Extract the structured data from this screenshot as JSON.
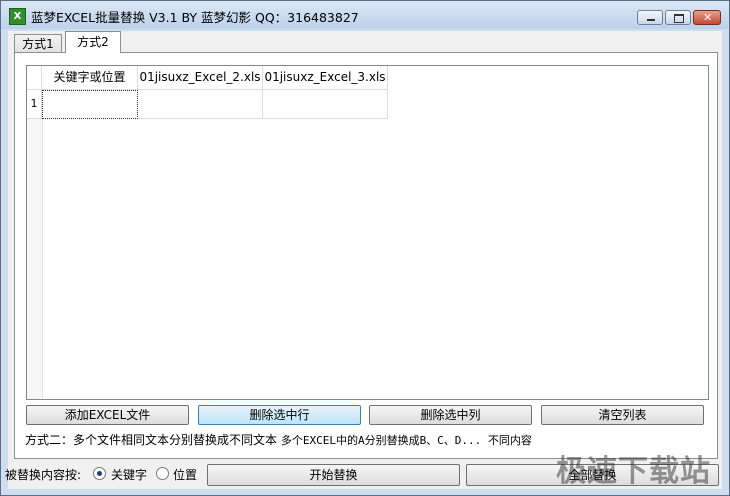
{
  "window": {
    "title": "蓝梦EXCEL批量替换 V3.1 BY 蓝梦幻影 QQ：316483827",
    "icon_letter": "X"
  },
  "tabs": [
    {
      "label": "方式1",
      "active": false
    },
    {
      "label": "方式2",
      "active": true
    }
  ],
  "grid": {
    "columns": [
      "关键字或位置",
      "01jisuxz_Excel_2.xls",
      "01jisuxz_Excel_3.xls"
    ],
    "rows": [
      {
        "row_number": "1",
        "cells": [
          "",
          "",
          ""
        ]
      }
    ]
  },
  "buttons": {
    "add_excel": "添加EXCEL文件",
    "delete_row": "删除选中行",
    "delete_column": "删除选中列",
    "clear_list": "清空列表",
    "start_replace": "开始替换",
    "all_replace": "全部替换"
  },
  "hint": {
    "prefix": "方式二：多个文件相同文本分别替换成不同文本  ",
    "mono": "多个EXCEL中的A分别替换成B、C、D... 不同内容"
  },
  "replace_by": {
    "label": "被替换内容按:",
    "options": [
      {
        "label": "关键字",
        "checked": true
      },
      {
        "label": "位置",
        "checked": false
      }
    ]
  },
  "watermark": "极速下载站"
}
